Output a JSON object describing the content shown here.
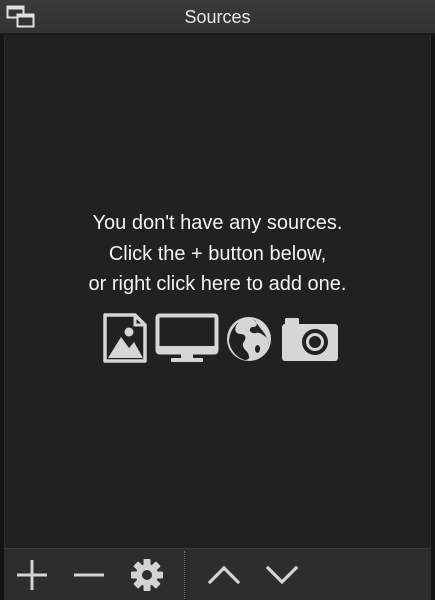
{
  "dock": {
    "title": "Sources",
    "float_button_icon": "undock-windows-icon"
  },
  "sources_list": {
    "empty_message": {
      "line1": "You don't have any sources.",
      "line2": "Click the + button below,",
      "line3": "or right click here to add one."
    },
    "source_type_icons": [
      "image-icon",
      "display-icon",
      "globe-icon",
      "camera-icon"
    ]
  },
  "toolbar": {
    "buttons": [
      {
        "icon": "plus-icon",
        "action": "add"
      },
      {
        "icon": "minus-icon",
        "action": "remove"
      },
      {
        "icon": "gear-icon",
        "action": "properties"
      },
      {
        "icon": "chevron-up-icon",
        "action": "move up"
      },
      {
        "icon": "chevron-down-icon",
        "action": "move down"
      }
    ]
  },
  "colors": {
    "background": "#212121",
    "titlebar": "#353535",
    "toolbar": "#2d2d2d",
    "text": "#f2f2f2",
    "icon": "#d6d6d6"
  }
}
